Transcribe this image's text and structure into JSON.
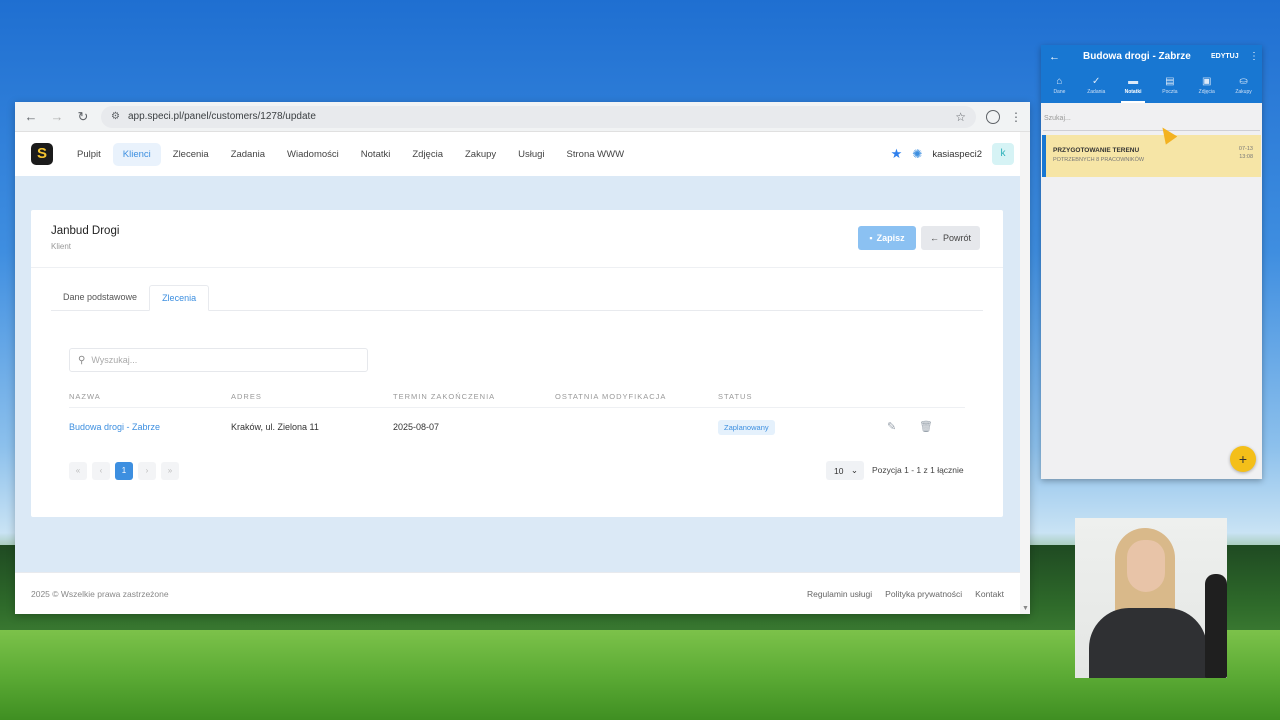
{
  "browser": {
    "url": "app.speci.pl/panel/customers/1278/update"
  },
  "nav": {
    "logo": "S",
    "items": [
      "Pulpit",
      "Klienci",
      "Zlecenia",
      "Zadania",
      "Wiadomości",
      "Notatki",
      "Zdjęcia",
      "Zakupy",
      "Usługi",
      "Strona WWW"
    ],
    "active_index": 1,
    "username": "kasiaspeci2",
    "user_initial": "k"
  },
  "card": {
    "title": "Janbud Drogi",
    "subtitle": "Klient",
    "save_label": "Zapisz",
    "back_label": "Powrót",
    "tabs": [
      "Dane podstawowe",
      "Zlecenia"
    ],
    "active_tab": 1,
    "search_placeholder": "Wyszukaj...",
    "columns": [
      "NAZWA",
      "ADRES",
      "TERMIN ZAKOŃCZENIA",
      "OSTATNIA MODYFIKACJA",
      "STATUS"
    ],
    "rows": [
      {
        "name": "Budowa drogi - Zabrze",
        "address": "Kraków, ul. Zielona 11",
        "deadline": "2025-08-07",
        "modified": "",
        "status": "Zaplanowany"
      }
    ],
    "pager": {
      "first": "«",
      "prev": "‹",
      "current": "1",
      "next": "›",
      "last": "»"
    },
    "per_page": "10",
    "page_info": "Pozycja 1 - 1 z 1 łącznie"
  },
  "footer": {
    "copyright": "2025 © Wszelkie prawa zastrzeżone",
    "links": [
      "Regulamin usługi",
      "Polityka prywatności",
      "Kontakt"
    ]
  },
  "phone": {
    "title": "Budowa drogi - Zabrze",
    "edit_label": "EDYTUJ",
    "tabs": [
      {
        "icon": "home-icon",
        "glyph": "⌂",
        "label": "Dane"
      },
      {
        "icon": "check-icon",
        "glyph": "✓",
        "label": "Zadania"
      },
      {
        "icon": "note-icon",
        "glyph": "▬",
        "label": "Notatki"
      },
      {
        "icon": "chat-icon",
        "glyph": "▤",
        "label": "Poczta"
      },
      {
        "icon": "image-icon",
        "glyph": "▣",
        "label": "Zdjęcia"
      },
      {
        "icon": "basket-icon",
        "glyph": "⛀",
        "label": "Zakupy"
      }
    ],
    "active_tab": 2,
    "search_placeholder": "Szukaj...",
    "note": {
      "title": "PRZYGOTOWANIE TERENU",
      "subtitle": "POTRZEBNYCH 8 PRACOWNIKÓW",
      "date": "07-13",
      "time": "13:08"
    },
    "fab": "+"
  },
  "colors": {
    "accent": "#3d8fe0",
    "phone_header": "#1877d2",
    "note_bg": "#f6e5a6",
    "fab": "#f4bf19"
  }
}
